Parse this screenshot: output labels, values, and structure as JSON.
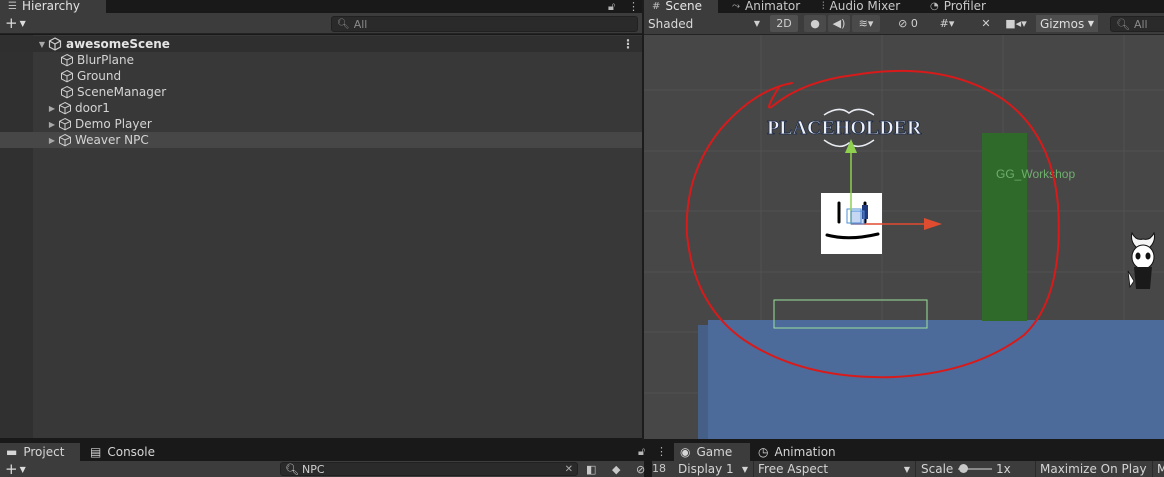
{
  "hierarchy": {
    "tab_label": "Hierarchy",
    "search_placeholder": "All",
    "scene_name": "awesomeScene",
    "objects": [
      {
        "name": "BlurPlane",
        "has_children": false
      },
      {
        "name": "Ground",
        "has_children": false
      },
      {
        "name": "SceneManager",
        "has_children": false
      },
      {
        "name": "door1",
        "has_children": true
      },
      {
        "name": "Demo Player",
        "has_children": true
      },
      {
        "name": "Weaver NPC",
        "has_children": true,
        "selected": true
      }
    ]
  },
  "scene_tabs": [
    "Scene",
    "Animator",
    "Audio Mixer",
    "Profiler"
  ],
  "scene_toolbar": {
    "shading_mode": "Shaded",
    "mode_2d": "2D",
    "hidden_count": "0",
    "gizmos_label": "Gizmos",
    "search_placeholder": "All"
  },
  "scene_view": {
    "placeholder_text": "PLACEHOLDER",
    "workshop_label": "GG_Workshop"
  },
  "bottom_left": {
    "tabs": [
      "Project",
      "Console"
    ],
    "search_value": "NPC",
    "visible_count": "18"
  },
  "bottom_right": {
    "tabs": [
      "Game",
      "Animation"
    ],
    "display": "Display 1",
    "aspect": "Free Aspect",
    "scale_label": "Scale",
    "scale_value": "1x",
    "maximize_label": "Maximize On Play",
    "truncated": "M"
  },
  "colors": {
    "panel": "#383838",
    "toolbar": "#3c3c3c",
    "scene_bg": "#474747",
    "ground_blue": "#4c6b9b",
    "workshop_green": "#2f6a2b",
    "annotation_red": "#d81a1a"
  }
}
